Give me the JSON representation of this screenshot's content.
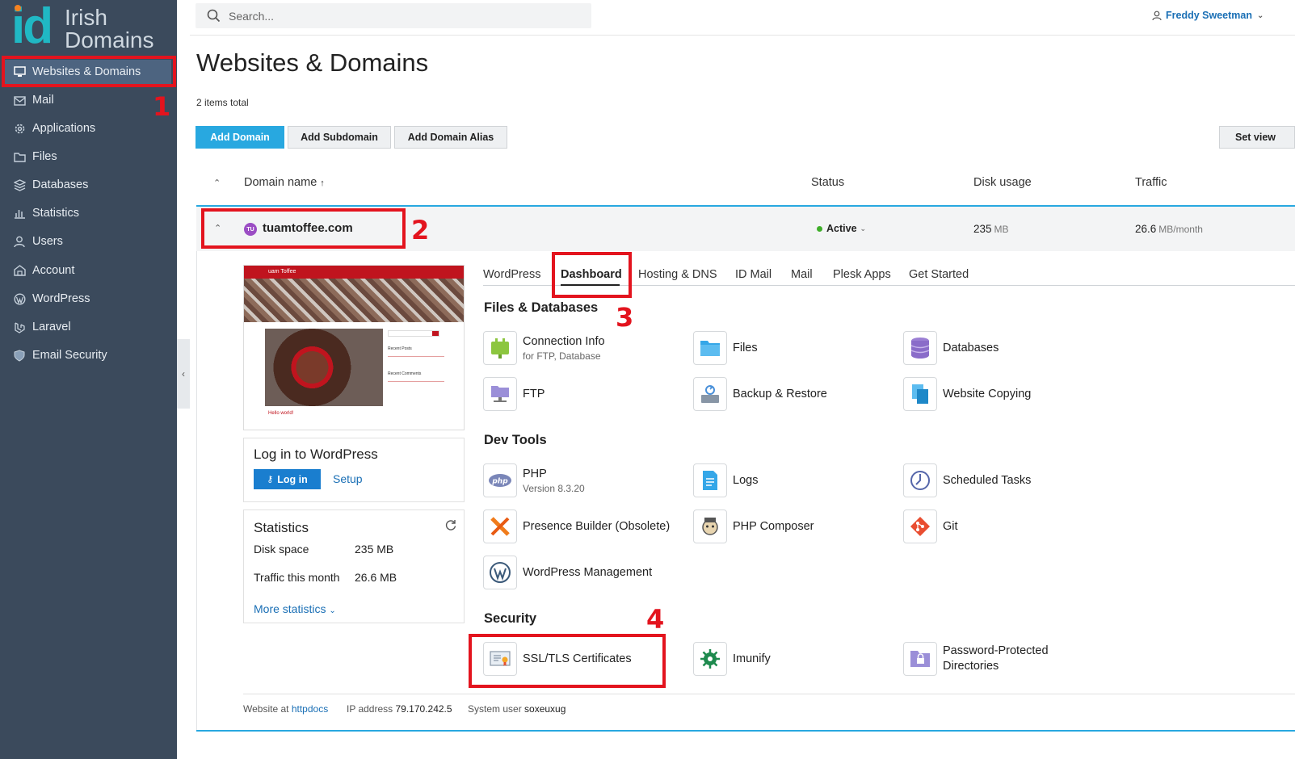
{
  "logo": {
    "mark": "id",
    "line1": "Irish",
    "line2": "Domains"
  },
  "sidebar": {
    "items": [
      {
        "label": "Websites & Domains",
        "icon": "monitor-icon",
        "active": true
      },
      {
        "label": "Mail",
        "icon": "mail-icon"
      },
      {
        "label": "Applications",
        "icon": "gear-icon"
      },
      {
        "label": "Files",
        "icon": "folder-icon"
      },
      {
        "label": "Databases",
        "icon": "database-icon"
      },
      {
        "label": "Statistics",
        "icon": "bar-chart-icon"
      },
      {
        "label": "Users",
        "icon": "user-icon"
      },
      {
        "label": "Account",
        "icon": "account-icon"
      },
      {
        "label": "WordPress",
        "icon": "wordpress-icon"
      },
      {
        "label": "Laravel",
        "icon": "laravel-icon"
      },
      {
        "label": "Email Security",
        "icon": "shield-icon"
      }
    ]
  },
  "annotations": {
    "n1": "1",
    "n2": "2",
    "n3": "3",
    "n4": "4"
  },
  "header": {
    "search_placeholder": "Search...",
    "user_name": "Freddy Sweetman"
  },
  "page": {
    "title": "Websites & Domains",
    "items_total": "2 items total"
  },
  "toolbar": {
    "add_domain": "Add Domain",
    "add_subdomain": "Add Subdomain",
    "add_domain_alias": "Add Domain Alias",
    "set_view": "Set view"
  },
  "table": {
    "columns": {
      "domain_name": "Domain name",
      "status": "Status",
      "disk_usage": "Disk usage",
      "traffic": "Traffic"
    }
  },
  "domain": {
    "avatar": "TU",
    "name": "tuamtoffee.com",
    "status": "Active",
    "disk_value": "235",
    "disk_unit": "MB",
    "traffic_value": "26.6",
    "traffic_unit": "MB/month"
  },
  "preview": {
    "site_title": "uam Toffee",
    "post_title": "Hello world!",
    "recent_posts": "Recent Posts",
    "recent_comments": "Recent Comments"
  },
  "wp_card": {
    "title": "Log in to WordPress",
    "login": "Log in",
    "setup": "Setup"
  },
  "stats_card": {
    "title": "Statistics",
    "disk_label": "Disk space",
    "disk_value": "235 MB",
    "traffic_label": "Traffic this month",
    "traffic_value": "26.6 MB",
    "more": "More statistics"
  },
  "tabs": [
    "WordPress",
    "Dashboard",
    "Hosting & DNS",
    "ID Mail",
    "Mail",
    "Plesk Apps",
    "Get Started"
  ],
  "sections": {
    "files_db": "Files & Databases",
    "dev_tools": "Dev Tools",
    "security": "Security"
  },
  "tools": {
    "connection_info": {
      "name": "Connection Info",
      "sub": "for FTP, Database"
    },
    "files": {
      "name": "Files"
    },
    "databases": {
      "name": "Databases"
    },
    "ftp": {
      "name": "FTP"
    },
    "backup": {
      "name": "Backup & Restore"
    },
    "website_copying": {
      "name": "Website Copying"
    },
    "php": {
      "name": "PHP",
      "sub": "Version 8.3.20",
      "badge": "php"
    },
    "logs": {
      "name": "Logs"
    },
    "scheduled_tasks": {
      "name": "Scheduled Tasks"
    },
    "presence_builder": {
      "name": "Presence Builder (Obsolete)"
    },
    "php_composer": {
      "name": "PHP Composer"
    },
    "git": {
      "name": "Git"
    },
    "wp_management": {
      "name": "WordPress Management"
    },
    "ssl": {
      "name": "SSL/TLS Certificates"
    },
    "imunify": {
      "name": "Imunify"
    },
    "password_dirs": {
      "name": "Password-Protected Directories",
      "line1": "Password-Protected",
      "line2": "Directories"
    }
  },
  "footer": {
    "website_at_label": "Website at",
    "website_at_value": "httpdocs",
    "ip_label": "IP address",
    "ip_value": "79.170.242.5",
    "sysuser_label": "System user",
    "sysuser_value": "soxeuxug"
  },
  "colors": {
    "sidebar_bg": "#3b4a5c",
    "accent": "#28a8e0",
    "annotation_red": "#e3141e",
    "active_green": "#3fae2a"
  }
}
